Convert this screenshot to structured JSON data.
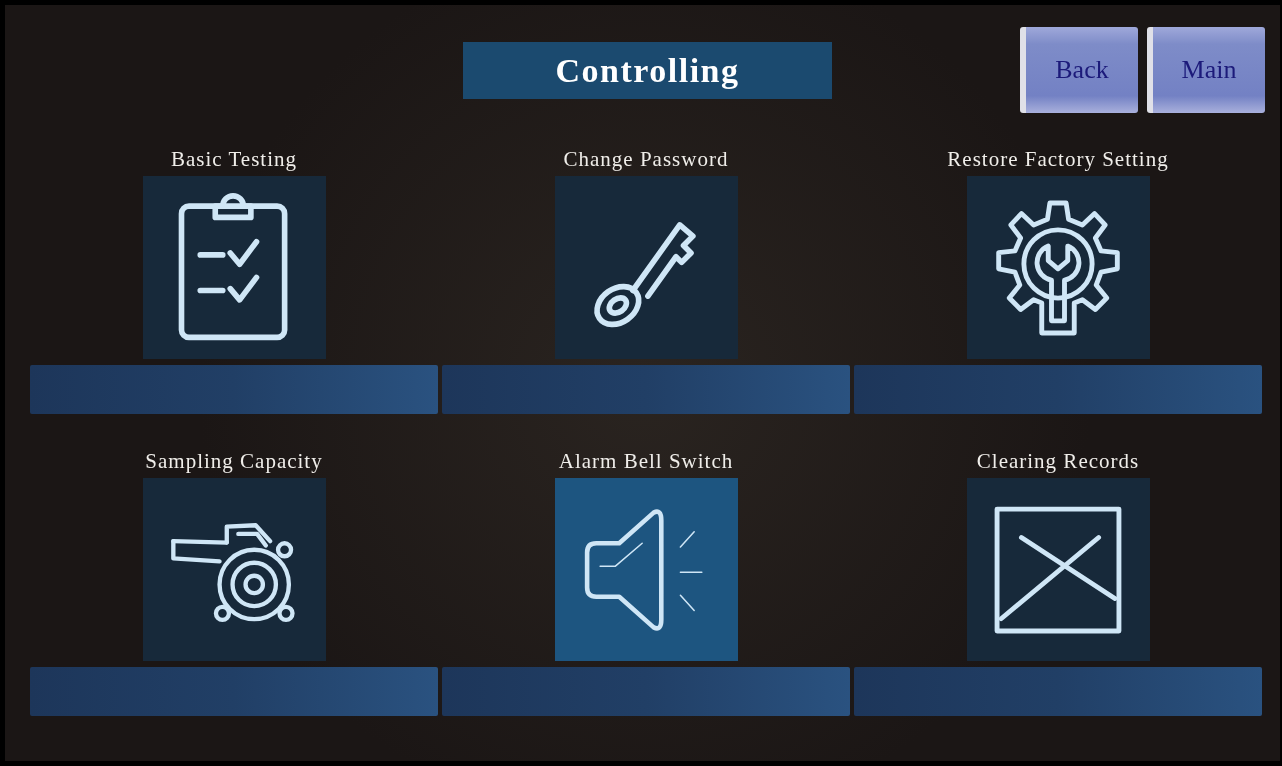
{
  "title": "Controlling",
  "buttons": [
    {
      "label": "Back"
    },
    {
      "label": "Main"
    }
  ],
  "items": [
    {
      "label": "Basic Testing",
      "selected": false
    },
    {
      "label": "Change Password",
      "selected": false
    },
    {
      "label": "Restore Factory Setting",
      "selected": false
    },
    {
      "label": "Sampling Capacity",
      "selected": false
    },
    {
      "label": "Alarm Bell Switch",
      "selected": true
    },
    {
      "label": "Clearing Records",
      "selected": false
    }
  ]
}
